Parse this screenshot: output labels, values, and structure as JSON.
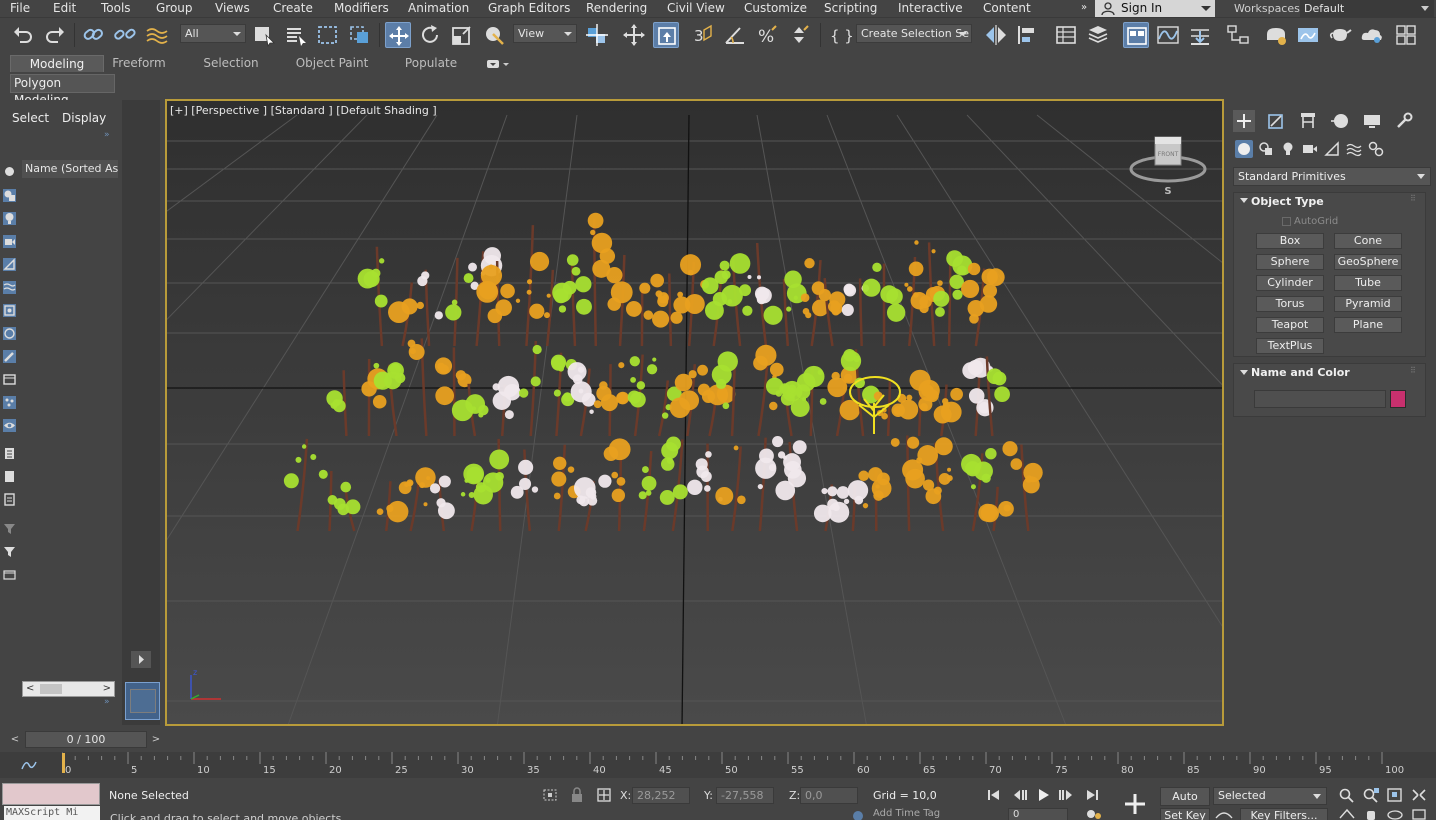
{
  "menu": {
    "items": [
      "File",
      "Edit",
      "Tools",
      "Group",
      "Views",
      "Create",
      "Modifiers",
      "Animation",
      "Graph Editors",
      "Rendering",
      "Civil View",
      "Customize",
      "Scripting",
      "Interactive",
      "Content"
    ],
    "more": "»",
    "sign_in": "Sign In",
    "workspaces_label": "Workspaces:",
    "workspace_value": "Default"
  },
  "toolbar": {
    "selection_filter": "All",
    "ref_coord": "View",
    "named_selection": "Create Selection Se"
  },
  "ribbon": {
    "tabs": [
      "Modeling",
      "Freeform",
      "Selection",
      "Object Paint",
      "Populate"
    ],
    "sub_label": "Polygon Modeling"
  },
  "explorer": {
    "tab_select": "Select",
    "tab_display": "Display",
    "column_header": "Name (Sorted Asce"
  },
  "viewport": {
    "label": "[+] [Perspective ] [Standard ] [Default Shading ]",
    "viewcube_front": "FRONT",
    "compass_s": "S",
    "axis_z": "z"
  },
  "command_panel": {
    "category": "Standard Primitives",
    "object_type_title": "Object Type",
    "autogrid": "AutoGrid",
    "buttons": [
      "Box",
      "Cone",
      "Sphere",
      "GeoSphere",
      "Cylinder",
      "Tube",
      "Torus",
      "Pyramid",
      "Teapot",
      "Plane",
      "TextPlus"
    ],
    "name_color_title": "Name and Color",
    "color": "#c8306e"
  },
  "timeline": {
    "frame_display": "0 / 100",
    "ticks": [
      "0",
      "5",
      "10",
      "15",
      "20",
      "25",
      "30",
      "35",
      "40",
      "45",
      "50",
      "55",
      "60",
      "65",
      "70",
      "75",
      "80",
      "85",
      "90",
      "95",
      "100"
    ]
  },
  "status": {
    "maxscript": "MAXScript Mi",
    "selection": "None Selected",
    "prompt": "Click and drag to select and move objects",
    "x_label": "X:",
    "x_value": "28,252",
    "y_label": "Y:",
    "y_value": "-27,558",
    "z_label": "Z:",
    "z_value": "0,0",
    "grid": "Grid = 10,0",
    "add_time_tag": "Add Time Tag",
    "auto_key": "Auto Key",
    "set_key": "Set Key",
    "key_mode": "Selected",
    "key_filters": "Key Filters...",
    "current_frame": "0"
  },
  "colors": {
    "viewport_border": "#b89b3a",
    "active_blue": "#5c7ea8",
    "tree_green": "#a8e030",
    "tree_orange": "#e8a020",
    "tree_white": "#f0e8ec",
    "trunk_brown": "#6b3a2a",
    "selected_yellow": "#f0e020"
  }
}
